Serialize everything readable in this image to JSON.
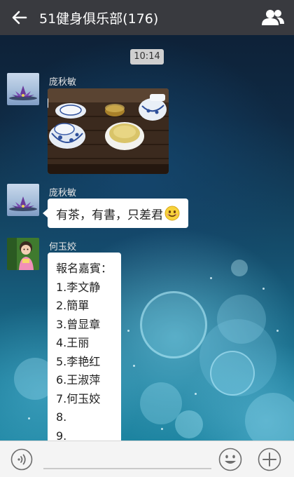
{
  "header": {
    "title": "51健身俱乐部(176)",
    "back_icon": "arrow-left-icon",
    "group_icon": "group-members-icon"
  },
  "chat": {
    "timestamp": "10:14",
    "messages": [
      {
        "sender": "庞秋敏",
        "type": "image",
        "image_desc_icon": "tea-set-photo"
      },
      {
        "sender": "庞秋敏",
        "type": "text",
        "text": "有茶，有書，只差君",
        "emoji": "smile-emoji-icon"
      },
      {
        "sender": "何玉姣",
        "type": "text",
        "lines": [
          "報名嘉賓：",
          "1.李文静",
          "2.簡單",
          "3.曾显章",
          "4.王丽",
          "5.李艳红",
          "6.王淑萍",
          "7.何玉姣",
          "8.",
          "9."
        ]
      }
    ]
  },
  "input_bar": {
    "voice_icon": "voice-input-icon",
    "emoji_icon": "emoji-icon",
    "plus_icon": "plus-icon",
    "text_value": ""
  },
  "colors": {
    "topbar": "#393a3f",
    "bubble": "#ffffff",
    "input_bar": "#f4f4f4"
  }
}
